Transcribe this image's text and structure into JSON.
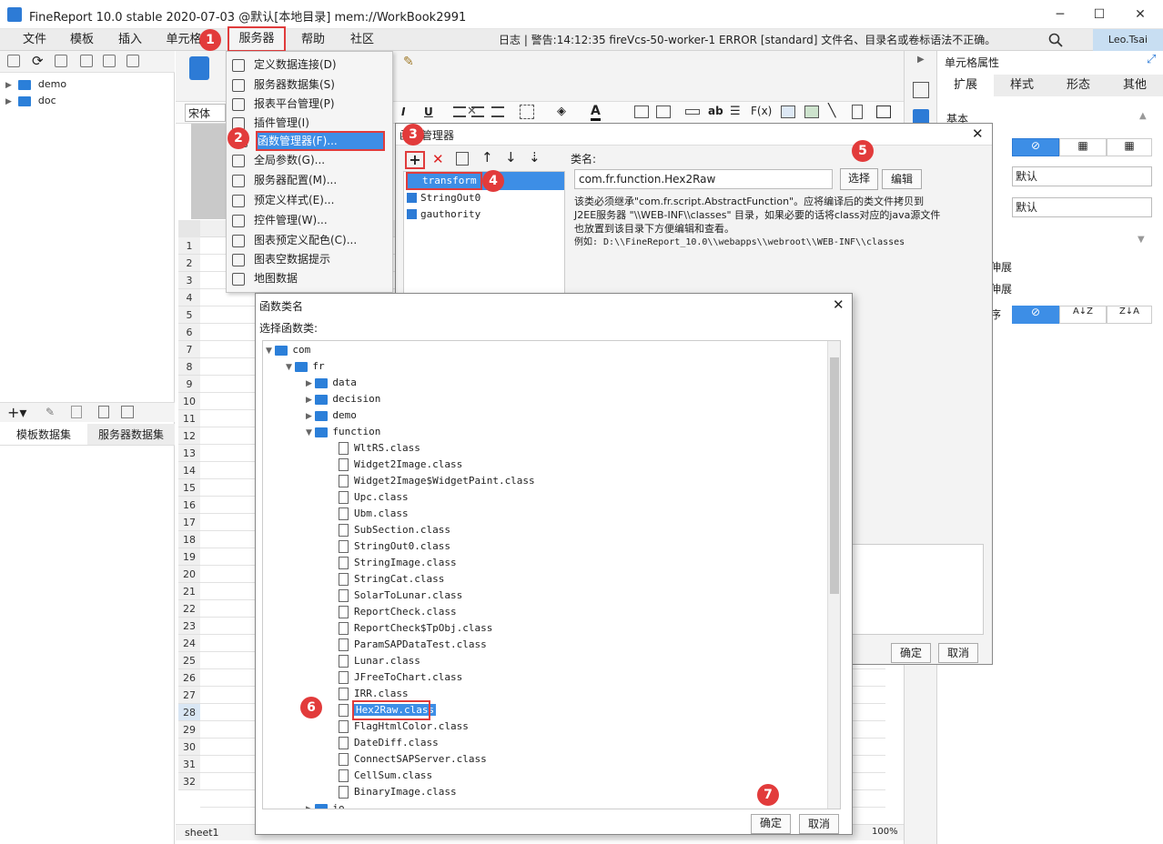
{
  "window": {
    "title": "FineReport 10.0 stable 2020-07-03 @默认[本地目录]    mem://WorkBook2991",
    "controls": [
      "─",
      "☐",
      "✕"
    ]
  },
  "menubar": {
    "items": [
      "文件",
      "模板",
      "插入",
      "单元格",
      "服务器",
      "帮助",
      "社区"
    ],
    "log": "日志 | 警告:14:12:35 fireVcs-50-worker-1 ERROR [standard] 文件名、目录名或卷标语法不正确。",
    "user": "Leo.Tsai"
  },
  "left_panel": {
    "tree": [
      "demo",
      "doc"
    ],
    "tabs": [
      "模板数据集",
      "服务器数据集"
    ]
  },
  "center": {
    "font": "宋体",
    "sheet_tab": "sheet1",
    "zoom": "100%",
    "rows": [
      "1",
      "2",
      "3",
      "4",
      "5",
      "6",
      "7",
      "8",
      "9",
      "10",
      "11",
      "12",
      "13",
      "14",
      "15",
      "16",
      "17",
      "18",
      "19",
      "20",
      "21",
      "22",
      "23",
      "24",
      "25",
      "26",
      "27",
      "28",
      "29",
      "30",
      "31",
      "32"
    ],
    "active_row": "28",
    "tab_close": "✕"
  },
  "right_panel": {
    "title": "单元格属性",
    "tabs": [
      "扩展",
      "样式",
      "形态",
      "其他"
    ],
    "section": "基本",
    "select1": "默认",
    "select2": "默认",
    "expand_labels": [
      "伸展",
      "伸展",
      "序"
    ]
  },
  "server_menu": {
    "items": [
      "定义数据连接(D)",
      "服务器数据集(S)",
      "报表平台管理(P)",
      "插件管理(I)",
      "函数管理器(F)...",
      "全局参数(G)...",
      "服务器配置(M)...",
      "预定义样式(E)...",
      "控件管理(W)...",
      "图表预定义配色(C)...",
      "图表空数据提示",
      "地图数据"
    ]
  },
  "function_manager": {
    "title": "函数管理器",
    "functions": [
      "transform",
      "StringOut0",
      "gauthority"
    ],
    "class_label": "类名:",
    "class_value": "com.fr.function.Hex2Raw",
    "select_btn": "选择",
    "edit_btn": "编辑",
    "desc1": "该类必须继承\"com.fr.script.AbstractFunction\"。应将编译后的类文件拷贝到",
    "desc2": "J2EE服务器 \"\\\\WEB-INF\\\\classes\" 目录，如果必要的话将class对应的java源文件",
    "desc3": "也放置到该目录下方便编辑和查看。",
    "desc4": "例如: D:\\\\FineReport_10.0\\\\webapps\\\\webroot\\\\WEB-INF\\\\classes",
    "ok": "确定",
    "cancel": "取消"
  },
  "class_dialog": {
    "title": "函数类名",
    "subtitle": "选择函数类:",
    "root": "com",
    "fr": "fr",
    "folders": [
      "data",
      "decision",
      "demo",
      "function"
    ],
    "classes": [
      "WltRS.class",
      "Widget2Image.class",
      "Widget2Image$WidgetPaint.class",
      "Upc.class",
      "Ubm.class",
      "SubSection.class",
      "StringOut0.class",
      "StringImage.class",
      "StringCat.class",
      "SolarToLunar.class",
      "ReportCheck.class",
      "ReportCheck$TpObj.class",
      "ParamSAPDataTest.class",
      "Lunar.class",
      "JFreeToChart.class",
      "IRR.class",
      "Hex2Raw.class",
      "FlagHtmlColor.class",
      "DateDiff.class",
      "ConnectSAPServer.class",
      "CellSum.class",
      "BinaryImage.class"
    ],
    "selected": "Hex2Raw.class",
    "last_folder": "io",
    "ok": "确定",
    "cancel": "取消"
  },
  "annotations": {
    "badges": [
      "1",
      "2",
      "3",
      "4",
      "5",
      "6",
      "7"
    ],
    "color": "#e23b3b"
  }
}
